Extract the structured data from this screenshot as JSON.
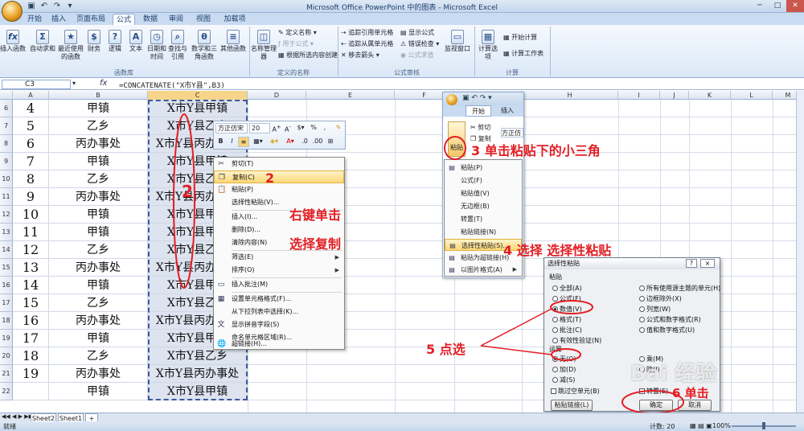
{
  "window": {
    "title": "Microsoft Office PowerPoint 中的图表 - Microsoft Excel"
  },
  "ribbon_tabs": [
    "开始",
    "插入",
    "页面布局",
    "公式",
    "数据",
    "审阅",
    "视图",
    "加载项"
  ],
  "active_tab": "公式",
  "ribbon": {
    "groups": {
      "function_library": "函数库",
      "defined_names": "定义的名称",
      "formula_auditing": "公式审核",
      "calculation": "计算"
    },
    "buttons": {
      "insert_function": "插入函数",
      "autosum": "自动求和",
      "recent": "最近使用的函数",
      "financial": "财务",
      "logical": "逻辑",
      "text": "文本",
      "datetime": "日期和时间",
      "lookup": "查找与引用",
      "math": "数学和三角函数",
      "other": "其他函数",
      "name_manager": "名称管理器",
      "define_name": "定义名称",
      "use_in_formula": "用于公式",
      "create_from_selection": "根据所选内容创建",
      "trace_precedents": "追踪引用单元格",
      "trace_dependents": "追踪从属单元格",
      "remove_arrows": "移去箭头",
      "show_formulas": "显示公式",
      "error_checking": "错误检查",
      "evaluate_formula": "公式求值",
      "watch_window": "监视窗口",
      "calc_options": "计算选项",
      "calc_now": "开始计算",
      "calc_sheet": "计算工作表"
    }
  },
  "formula_bar": {
    "name_box": "C3",
    "fx": "fx",
    "formula": "=CONCATENATE(\"X市Y县\",B3)"
  },
  "columns": [
    "A",
    "B",
    "C",
    "D",
    "E",
    "F",
    "G",
    "H",
    "I",
    "J",
    "K",
    "L",
    "M"
  ],
  "rows": [
    {
      "num": "6",
      "a": "4",
      "b": "甲镇",
      "c": "X市Y县甲镇"
    },
    {
      "num": "7",
      "a": "5",
      "b": "乙乡",
      "c": "X市Y县乙乡"
    },
    {
      "num": "8",
      "a": "6",
      "b": "丙办事处",
      "c": "X市Y县丙办事处"
    },
    {
      "num": "9",
      "a": "7",
      "b": "甲镇",
      "c": "X市Y县甲镇"
    },
    {
      "num": "10",
      "a": "8",
      "b": "乙乡",
      "c": "X市Y县乙乡"
    },
    {
      "num": "11",
      "a": "9",
      "b": "丙办事处",
      "c": "X市Y县丙办事处"
    },
    {
      "num": "12",
      "a": "10",
      "b": "甲镇",
      "c": "X市Y县甲镇"
    },
    {
      "num": "13",
      "a": "11",
      "b": "甲镇",
      "c": "X市Y县甲镇"
    },
    {
      "num": "14",
      "a": "12",
      "b": "乙乡",
      "c": "X市Y县乙乡"
    },
    {
      "num": "15",
      "a": "13",
      "b": "丙办事处",
      "c": "X市Y县丙办事处"
    },
    {
      "num": "16",
      "a": "14",
      "b": "甲镇",
      "c": "X市Y县甲镇"
    },
    {
      "num": "17",
      "a": "15",
      "b": "乙乡",
      "c": "X市Y县乙乡"
    },
    {
      "num": "18",
      "a": "16",
      "b": "丙办事处",
      "c": "X市Y县丙办事处"
    },
    {
      "num": "19",
      "a": "17",
      "b": "甲镇",
      "c": "X市Y县甲镇"
    },
    {
      "num": "20",
      "a": "18",
      "b": "乙乡",
      "c": "X市Y县乙乡"
    },
    {
      "num": "21",
      "a": "19",
      "b": "丙办事处",
      "c": "X市Y县丙办事处"
    },
    {
      "num": "22",
      "a": "",
      "b": "甲镇",
      "c": "X市Y县甲镇"
    }
  ],
  "mini_toolbar": {
    "font": "方正仿宋",
    "size": "20"
  },
  "context_menu": [
    "剪切(T)",
    "复制(C)",
    "粘贴(P)",
    "选择性粘贴(V)...",
    "插入(I)...",
    "删除(D)...",
    "清除内容(N)",
    "筛选(E)",
    "排序(O)",
    "插入批注(M)",
    "设置单元格格式(F)...",
    "从下拉列表中选择(K)...",
    "显示拼音字段(S)",
    "命名单元格区域(R)...",
    "超链接(H)..."
  ],
  "inset": {
    "tabs": [
      "开始",
      "插入"
    ],
    "paste_label": "粘贴",
    "cut": "剪切",
    "copy": "复制",
    "font": "方正仿",
    "menu": [
      "粘贴(P)",
      "公式(F)",
      "粘贴值(V)",
      "无边框(B)",
      "转置(T)",
      "粘贴链接(N)",
      "选择性粘贴(S)...",
      "粘贴为超链接(H)",
      "以图片格式(A)"
    ]
  },
  "dialog": {
    "title": "选择性粘贴",
    "help": "?",
    "close": "×",
    "paste_section": "粘贴",
    "paste_left": [
      "全部(A)",
      "公式(F)",
      "数值(V)",
      "格式(T)",
      "批注(C)",
      "有效性验证(N)"
    ],
    "paste_right": [
      "所有使用源主题的单元(H)",
      "边框除外(X)",
      "列宽(W)",
      "公式和数字格式(R)",
      "值和数字格式(U)"
    ],
    "op_section": "运算",
    "op_left": [
      "无(O)",
      "加(D)",
      "减(S)"
    ],
    "op_right": [
      "乘(M)",
      "除(I)"
    ],
    "skip_blanks": "跳过空单元(B)",
    "transpose": "转置(E)",
    "paste_link": "粘贴链接(L)",
    "ok": "确定",
    "cancel": "取消"
  },
  "annotations": {
    "a1": "2",
    "a2": "2",
    "a3": "右键单击",
    "a4": "选择复制",
    "a5": "3 单击粘贴下的小三角",
    "a6": "4 选择  选择性粘贴",
    "a7": "5  点选",
    "a8": "6  单击"
  },
  "sheet_tabs": [
    "Sheet2",
    "Sheet1"
  ],
  "status": {
    "ready": "就绪",
    "count": "计数: 20",
    "zoom": "100%"
  },
  "watermark": "Bai 经验",
  "colors": {
    "annotation": "#e31e24",
    "selection": "#dde3ef",
    "ribbon": "#dbe8f7"
  }
}
